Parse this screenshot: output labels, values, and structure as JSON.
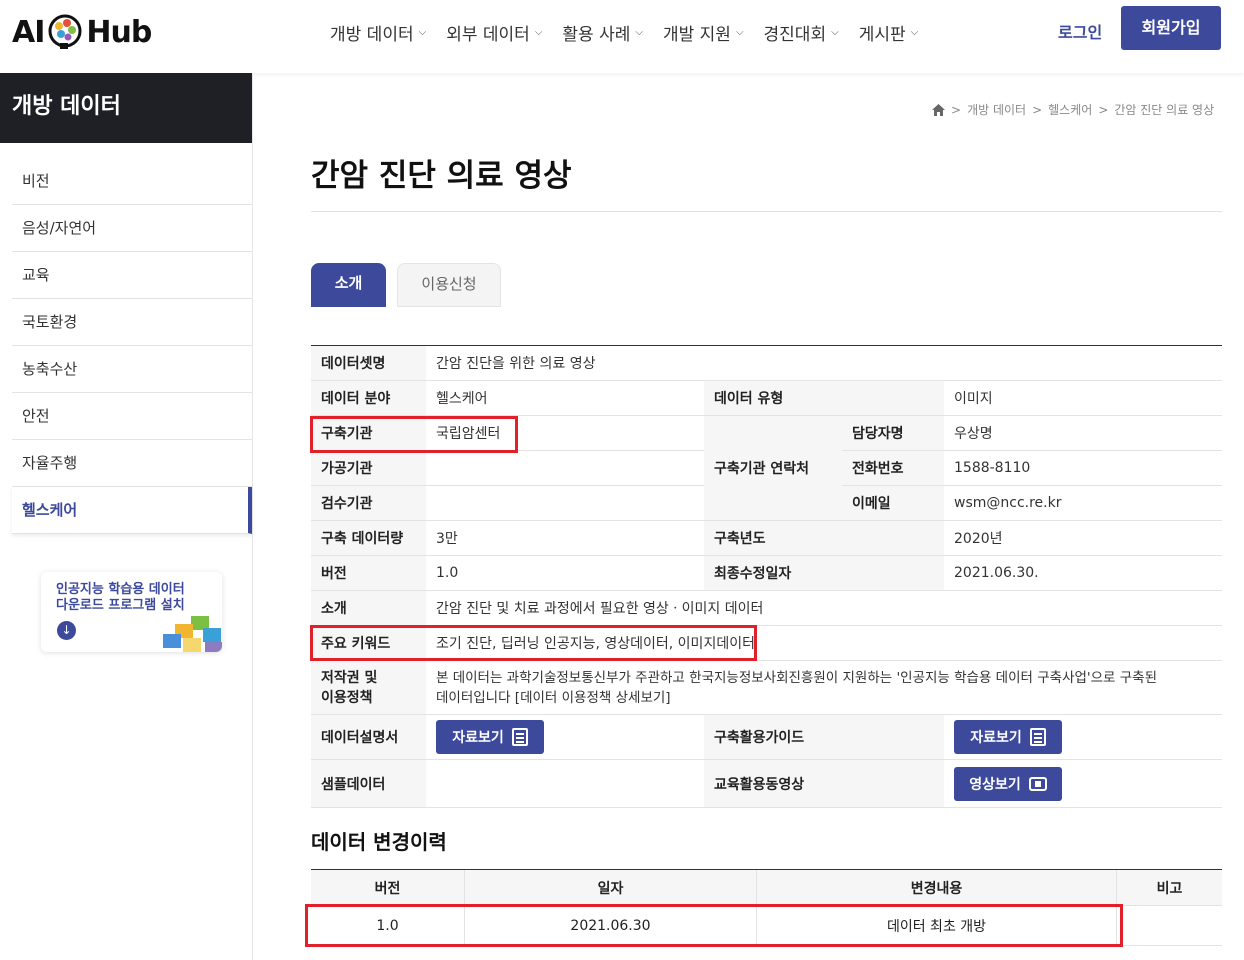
{
  "header": {
    "logo_left": "AI",
    "logo_right": "Hub",
    "nav": [
      "개방 데이터",
      "외부 데이터",
      "활용 사례",
      "개발 지원",
      "경진대회",
      "게시판"
    ],
    "login": "로그인",
    "signup": "회원가입"
  },
  "sidebar": {
    "title": "개방 데이터",
    "items": [
      "비전",
      "음성/자연어",
      "교육",
      "국토환경",
      "농축수산",
      "안전",
      "자율주행",
      "헬스케어"
    ],
    "active": "헬스케어",
    "promo_line1": "인공지능 학습용 데이터",
    "promo_line2": "다운로드 프로그램 설치"
  },
  "breadcrumb": [
    "개방 데이터",
    "헬스케어",
    "간암 진단 의료 영상"
  ],
  "page_title": "간암 진단 의료 영상",
  "tabs": [
    "소개",
    "이용신청"
  ],
  "info": {
    "dataset_label": "데이터셋명",
    "dataset": "간암 진단을 위한 의료 영상",
    "field_label": "데이터 분야",
    "field": "헬스케어",
    "type_label": "데이터 유형",
    "type": "이미지",
    "org_label": "구축기관",
    "org": "국립암센터",
    "proc_label": "가공기관",
    "insp_label": "검수기관",
    "contact_label": "구축기관 연락처",
    "manager_label": "담당자명",
    "manager": "우상명",
    "phone_label": "전화번호",
    "phone": "1588-8110",
    "email_label": "이메일",
    "email": "wsm@ncc.re.kr",
    "amount_label": "구축 데이터량",
    "amount": "3만",
    "year_label": "구축년도",
    "year": "2020년",
    "version_label": "버전",
    "version": "1.0",
    "modified_label": "최종수정일자",
    "modified": "2021.06.30.",
    "intro_label": "소개",
    "intro": "간암 진단 및 치료 과정에서 필요한 영상ㆍ이미지 데이터",
    "keyword_label": "주요 키워드",
    "keyword": "조기 진단, 딥러닝 인공지능, 영상데이터, 이미지데이터",
    "copyright_label_1": "저작권 및",
    "copyright_label_2": "이용정책",
    "copyright_1": "본 데이터는 과학기술정보통신부가 주관하고 한국지능정보사회진흥원이 지원하는 '인공지능 학습용 데이터 구축사업'으로 구축된",
    "copyright_2": "데이터입니다 [데이터 이용정책 상세보기]",
    "manual_label": "데이터설명서",
    "view_doc": "자료보기",
    "guide_label": "구축활용가이드",
    "sample_label": "샘플데이터",
    "edu_label": "교육활용동영상",
    "view_video": "영상보기"
  },
  "history": {
    "title": "데이터 변경이력",
    "headers": [
      "버전",
      "일자",
      "변경내용",
      "비고"
    ],
    "rows": [
      [
        "1.0",
        "2021.06.30",
        "데이터 최초 개방",
        ""
      ]
    ]
  },
  "colors": {
    "accent": "#3d4a9c",
    "highlight": "#e0202a",
    "sidebar_dark": "#1e2025"
  }
}
